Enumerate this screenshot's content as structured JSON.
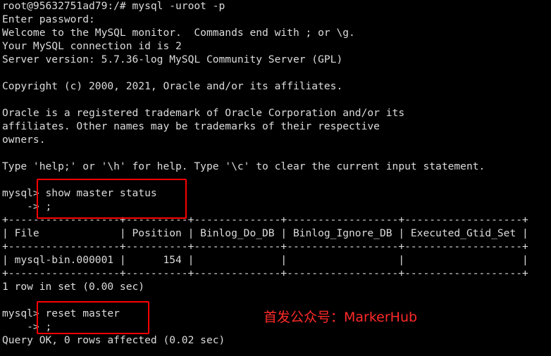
{
  "terminal": {
    "lines": [
      "root@95632751ad79:/# mysql -uroot -p",
      "Enter password:",
      "Welcome to the MySQL monitor.  Commands end with ; or \\g.",
      "Your MySQL connection id is 2",
      "Server version: 5.7.36-log MySQL Community Server (GPL)",
      "",
      "Copyright (c) 2000, 2021, Oracle and/or its affiliates.",
      "",
      "Oracle is a registered trademark of Oracle Corporation and/or its",
      "affiliates. Other names may be trademarks of their respective",
      "owners.",
      "",
      "Type 'help;' or '\\h' for help. Type '\\c' to clear the current input statement.",
      "",
      "mysql> show master status",
      "    -> ;",
      "+------------------+----------+--------------+------------------+-------------------+",
      "| File             | Position | Binlog_Do_DB | Binlog_Ignore_DB | Executed_Gtid_Set |",
      "+------------------+----------+--------------+------------------+-------------------+",
      "| mysql-bin.000001 |      154 |              |                  |                   |",
      "+------------------+----------+--------------+------------------+-------------------+",
      "1 row in set (0.00 sec)",
      "",
      "mysql> reset master",
      "    -> ;",
      "Query OK, 0 rows affected (0.02 sec)"
    ]
  },
  "watermark": {
    "text": "首发公众号：MarkerHub"
  },
  "colors": {
    "background": "#000000",
    "text": "#dcdcdc",
    "highlight": "#ff0000",
    "watermark": "#ff2a2a"
  }
}
